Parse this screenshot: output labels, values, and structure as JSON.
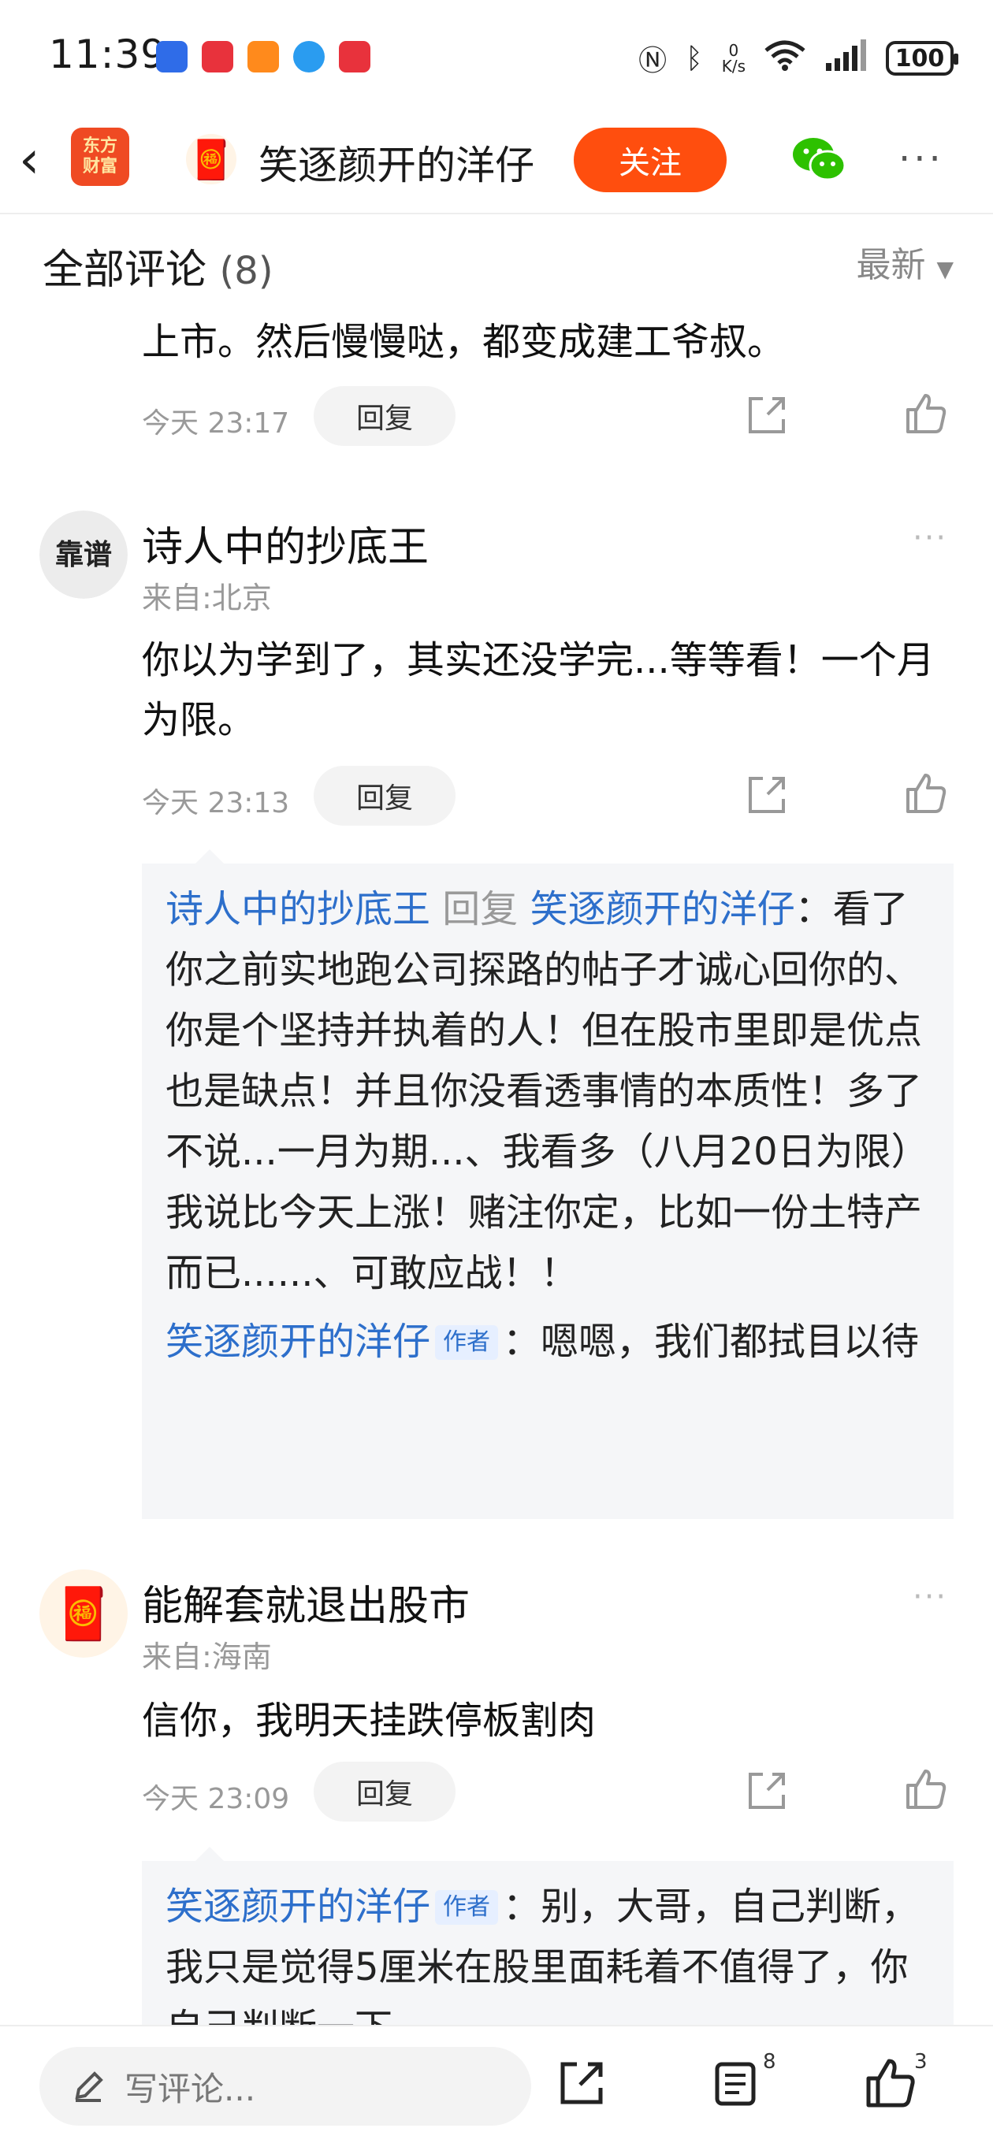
{
  "status_bar": {
    "time": "11:39",
    "battery": "100",
    "net_speed_value": "0",
    "net_speed_unit": "K/s",
    "signal_label": "6"
  },
  "header": {
    "app_logo_line1": "东方",
    "app_logo_line2": "财富",
    "author_name": "笑逐颜开的洋仔",
    "follow_label": "关注"
  },
  "section": {
    "title": "全部评论",
    "count": "(8)",
    "sort_label": "最新"
  },
  "comments": [
    {
      "text": "上市。然后慢慢哒，都变成建工爷叔。",
      "time": "今天 23:17",
      "reply_label": "回复"
    },
    {
      "username": "诗人中的抄底王",
      "location": "来自:北京",
      "text": "你以为学到了，其实还没学完...等等看！一个月为限。",
      "time": "今天 23:13",
      "reply_label": "回复",
      "avatar_text": "靠谱",
      "replies": [
        {
          "from": "诗人中的抄底王",
          "reply_word": "回复",
          "to": "笑逐颜开的洋仔",
          "text": "看了你之前实地跑公司探路的帖子才诚心回你的、你是个坚持并执着的人！但在股市里即是优点也是缺点！并且你没看透事情的本质性！多了不说...一月为期...、我看多（八月20日为限）我说比今天上涨！赌注你定，比如一份土特产而已......、可敢应战！！"
        },
        {
          "from": "笑逐颜开的洋仔",
          "tag": "作者",
          "text": "嗯嗯，我们都拭目以待"
        }
      ]
    },
    {
      "username": "能解套就退出股市",
      "location": "来自:海南",
      "text": "信你，我明天挂跌停板割肉",
      "time": "今天 23:09",
      "reply_label": "回复",
      "replies": [
        {
          "from": "笑逐颜开的洋仔",
          "tag": "作者",
          "text": "别，大哥，自己判断，我只是觉得5厘米在股里面耗着不值得了，你自己判断一下"
        }
      ]
    }
  ],
  "bottom_bar": {
    "input_placeholder": "写评论...",
    "comment_count": "8",
    "like_count": "3"
  },
  "colors": {
    "accent_orange": "#ff4e0e",
    "link_blue": "#2d6fcb",
    "wechat_green": "#2dc100"
  }
}
